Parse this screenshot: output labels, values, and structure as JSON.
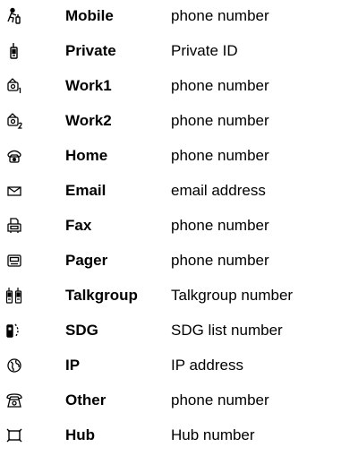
{
  "entries": [
    {
      "icon": "mobile-person-icon",
      "name": "Mobile",
      "description": "phone number"
    },
    {
      "icon": "radio-handset-icon",
      "name": "Private",
      "description": "Private ID"
    },
    {
      "icon": "work1-phone-icon",
      "name": "Work1",
      "description": "phone number"
    },
    {
      "icon": "work2-phone-icon",
      "name": "Work2",
      "description": "phone number"
    },
    {
      "icon": "home-phone-icon",
      "name": "Home",
      "description": "phone number"
    },
    {
      "icon": "envelope-icon",
      "name": "Email",
      "description": "email address"
    },
    {
      "icon": "fax-icon",
      "name": "Fax",
      "description": "phone number"
    },
    {
      "icon": "pager-icon",
      "name": "Pager",
      "description": "phone number"
    },
    {
      "icon": "talkgroup-radios-icon",
      "name": "Talkgroup",
      "description": "Talkgroup number"
    },
    {
      "icon": "sdg-radio-icon",
      "name": "SDG",
      "description": "SDG list number"
    },
    {
      "icon": "globe-icon",
      "name": "IP",
      "description": "IP address"
    },
    {
      "icon": "telephone-icon",
      "name": "Other",
      "description": "phone number"
    },
    {
      "icon": "hub-icon",
      "name": "Hub",
      "description": "Hub number"
    }
  ]
}
